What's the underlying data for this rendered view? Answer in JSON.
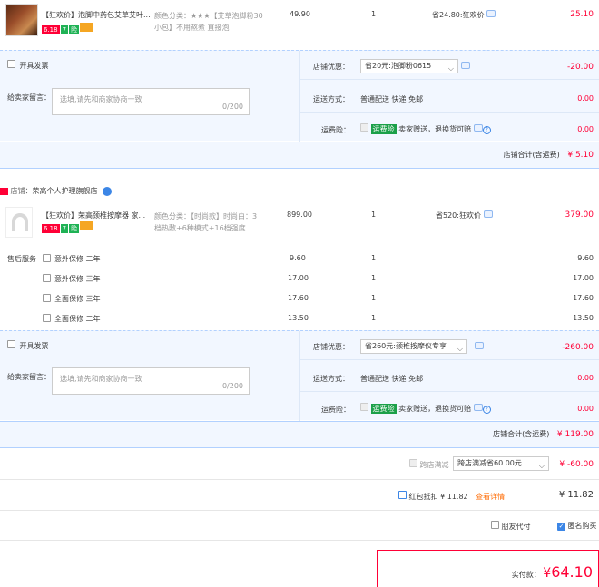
{
  "shop1": {
    "item": {
      "title": "【狂欢价】泡脚中药包艾草艾叶...",
      "sku_line1": "颜色分类：★★★【艾草泡脚粉30",
      "sku_line2": "小包】不用熬煮 直接泡",
      "price": "49.90",
      "qty": "1",
      "promo": "省24.80:狂欢价",
      "subtotal": "25.10"
    },
    "invoice_label": "开具发票",
    "store_promo_label": "店铺优惠：",
    "store_promo_value": "省20元:泡脚粉0615",
    "store_promo_amount": "-20.00",
    "message_label": "给卖家留言：",
    "message_placeholder": "选填,请先和商家协商一致",
    "message_count": "0/200",
    "shipping_label": "运送方式：",
    "shipping_value": "普通配送 快递 免邮",
    "shipping_amount": "0.00",
    "insurance_label": "运费险：",
    "insurance_tag": "运费险",
    "insurance_text": "卖家赠送，退换货可赔",
    "insurance_amount": "0.00",
    "total_label": "店铺合计(含运费)",
    "total_value": "¥ 5.10"
  },
  "shop2": {
    "store_label": "店铺：",
    "store_name": "荣高个人护理旗舰店",
    "item": {
      "title": "【狂欢价】荣高颈椎按摩器 家...",
      "sku_line1": "颜色分类：【时尚款】时尚白：3",
      "sku_line2": "档热敷+6种模式+16档强度",
      "price": "899.00",
      "qty": "1",
      "promo": "省520:狂欢价",
      "subtotal": "379.00"
    },
    "aftersale_label": "售后服务",
    "services": [
      {
        "name": "意外保修 二年",
        "price": "9.60",
        "qty": "1",
        "total": "9.60"
      },
      {
        "name": "意外保修 三年",
        "price": "17.00",
        "qty": "1",
        "total": "17.00"
      },
      {
        "name": "全面保修 三年",
        "price": "17.60",
        "qty": "1",
        "total": "17.60"
      },
      {
        "name": "全面保修 二年",
        "price": "13.50",
        "qty": "1",
        "total": "13.50"
      }
    ],
    "invoice_label": "开具发票",
    "store_promo_label": "店铺优惠：",
    "store_promo_value": "省260元:颈椎按摩仪专享",
    "store_promo_amount": "-260.00",
    "message_label": "给卖家留言：",
    "message_placeholder": "选填,请先和商家协商一致",
    "message_count": "0/200",
    "shipping_label": "运送方式：",
    "shipping_value": "普通配送 快递 免邮",
    "shipping_amount": "0.00",
    "insurance_label": "运费险：",
    "insurance_tag": "运费险",
    "insurance_text": "卖家赠送，退换货可赔",
    "insurance_amount": "0.00",
    "total_label": "店铺合计(含运费)",
    "total_value": "¥ 119.00"
  },
  "cross_store": {
    "label": "跨店满减",
    "select": "跨店满减省60.00元",
    "amount": "¥ -60.00"
  },
  "redpacket": {
    "label": "红包抵扣 ¥ 11.82",
    "link": "查看详情",
    "amount": "¥ 11.82"
  },
  "options": {
    "friend_pay": "朋友代付",
    "anonymous": "匿名购买"
  },
  "pay": {
    "label": "实付款：",
    "currency": "¥",
    "value": "64.10"
  },
  "badges": [
    "6.18",
    "7",
    "险"
  ]
}
